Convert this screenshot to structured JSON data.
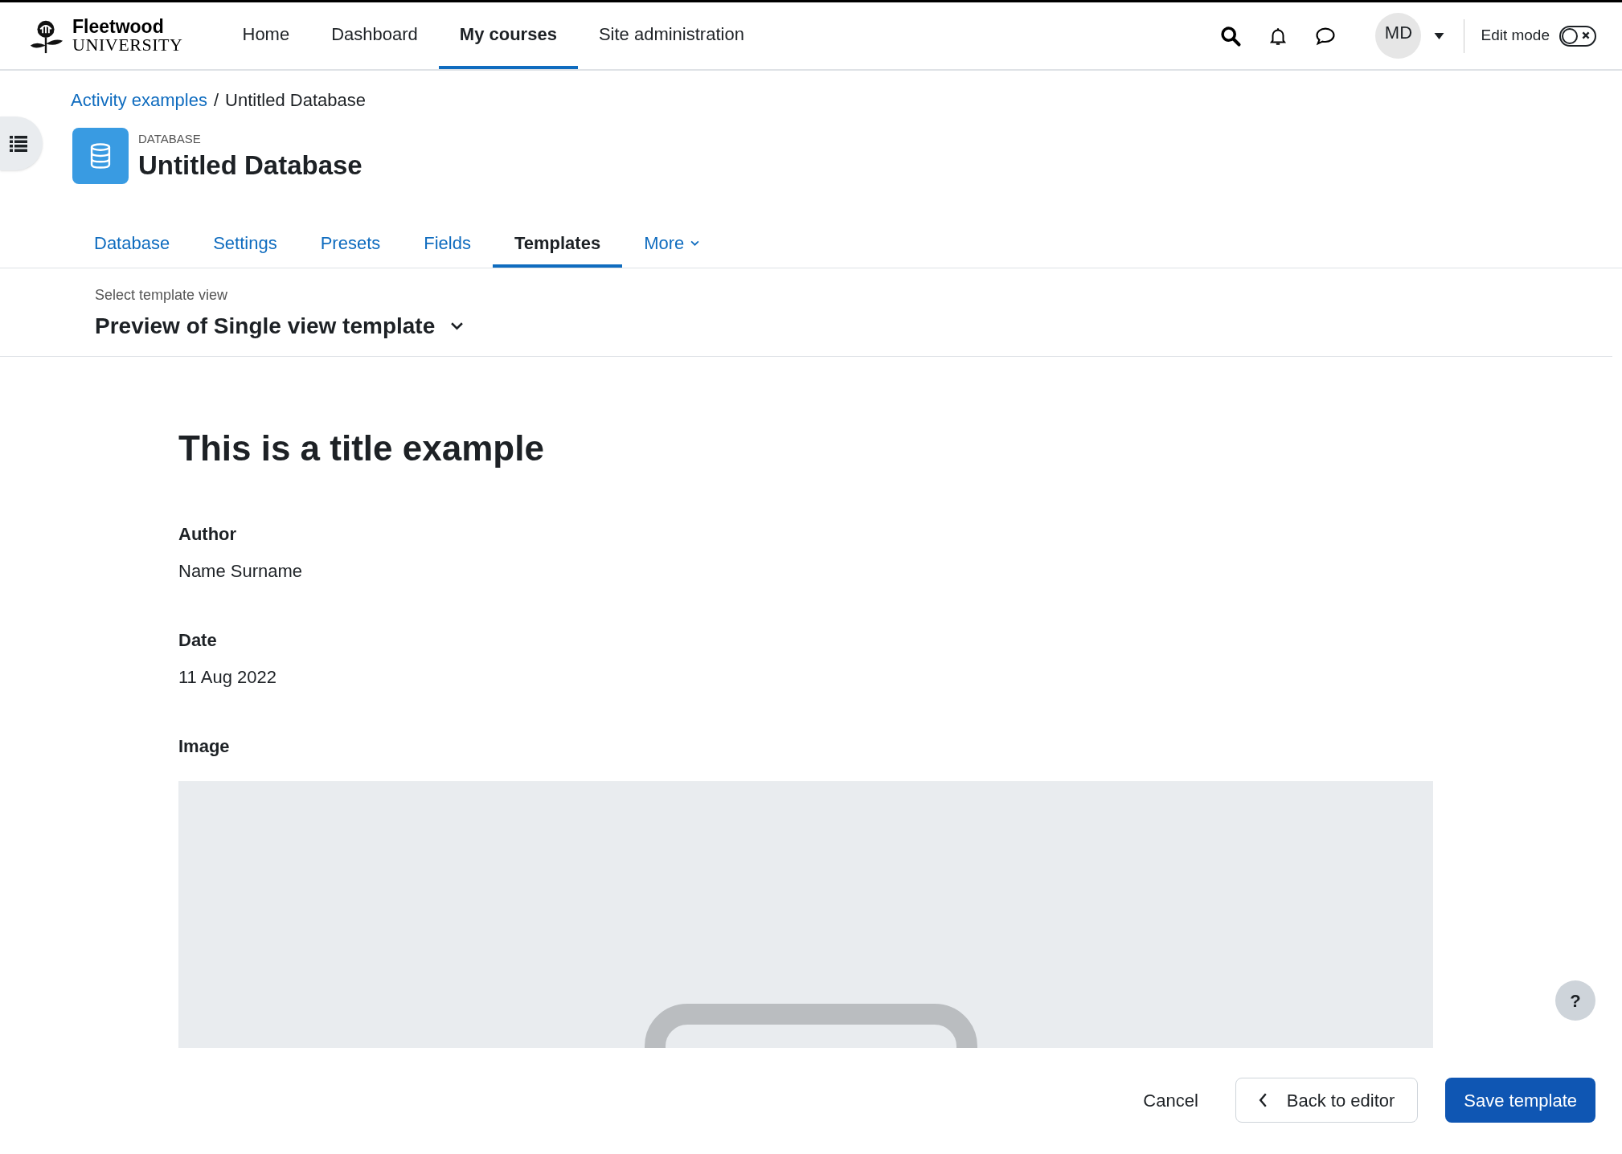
{
  "navbar": {
    "brand": {
      "name": "Fleetwood",
      "subtitle": "UNIVERSITY"
    },
    "links": [
      {
        "label": "Home",
        "selected": false
      },
      {
        "label": "Dashboard",
        "selected": false
      },
      {
        "label": "My courses",
        "selected": true
      },
      {
        "label": "Site administration",
        "selected": false
      }
    ],
    "avatar": "MD",
    "edit_mode": {
      "label": "Edit mode",
      "on": false
    }
  },
  "breadcrumb": {
    "separator": "/",
    "items": [
      {
        "label": "Activity examples",
        "link": true
      },
      {
        "label": "Untitled Database",
        "link": false
      }
    ]
  },
  "activity": {
    "type_label": "DATABASE",
    "title": "Untitled Database"
  },
  "tabs": [
    {
      "label": "Database",
      "selected": false,
      "kind": "tab"
    },
    {
      "label": "Settings",
      "selected": false,
      "kind": "tab"
    },
    {
      "label": "Presets",
      "selected": false,
      "kind": "tab"
    },
    {
      "label": "Fields",
      "selected": false,
      "kind": "tab"
    },
    {
      "label": "Templates",
      "selected": true,
      "kind": "tab"
    },
    {
      "label": "More",
      "selected": false,
      "kind": "menu"
    }
  ],
  "template_selector": {
    "label": "Select template view",
    "value": "Preview of Single view template"
  },
  "preview": {
    "title": "This is a title example",
    "fields": [
      {
        "label": "Author",
        "kind": "text",
        "value": "Name Surname"
      },
      {
        "label": "Date",
        "kind": "text",
        "value": "11 Aug 2022"
      },
      {
        "label": "Image",
        "kind": "image"
      }
    ]
  },
  "help_button": "?",
  "footer": {
    "buttons": [
      {
        "label": "Cancel",
        "kind": "link"
      },
      {
        "label": "Back to editor",
        "kind": "back"
      },
      {
        "label": "Save template",
        "kind": "primary"
      }
    ]
  }
}
